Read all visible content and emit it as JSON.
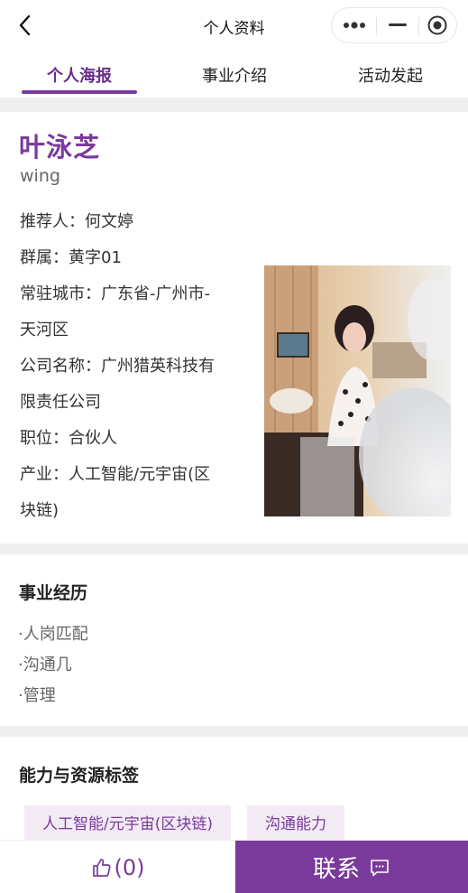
{
  "header": {
    "title": "个人资料",
    "back_icon": "chevron-left-icon",
    "capsule": [
      "more-dots-icon",
      "minimize-icon",
      "close-target-icon"
    ]
  },
  "tabs": [
    {
      "label": "个人海报",
      "active": true
    },
    {
      "label": "事业介绍",
      "active": false
    },
    {
      "label": "活动发起",
      "active": false
    }
  ],
  "profile": {
    "name": "叶泳芝",
    "english_name": "wing",
    "info_lines": [
      "推荐人：何文婷",
      "群属：黄字01",
      "常驻城市：广东省-广州市-",
      "天河区",
      "公司名称：广州猎英科技有",
      "限责任公司",
      "职位：合伙人",
      "产业：人工智能/元宇宙(区",
      "块链)"
    ]
  },
  "career": {
    "title": "事业经历",
    "items": [
      "·人岗匹配",
      "·沟通几",
      "·管理"
    ]
  },
  "tags_section": {
    "title": "能力与资源标签",
    "tags": [
      "人工智能/元宇宙(区块链)",
      "沟通能力"
    ]
  },
  "bottom": {
    "like_count": "(0)",
    "contact_label": "联系"
  },
  "colors": {
    "accent": "#7a3a9c",
    "tag_bg": "#f2ebf4",
    "gap": "#efefef"
  }
}
